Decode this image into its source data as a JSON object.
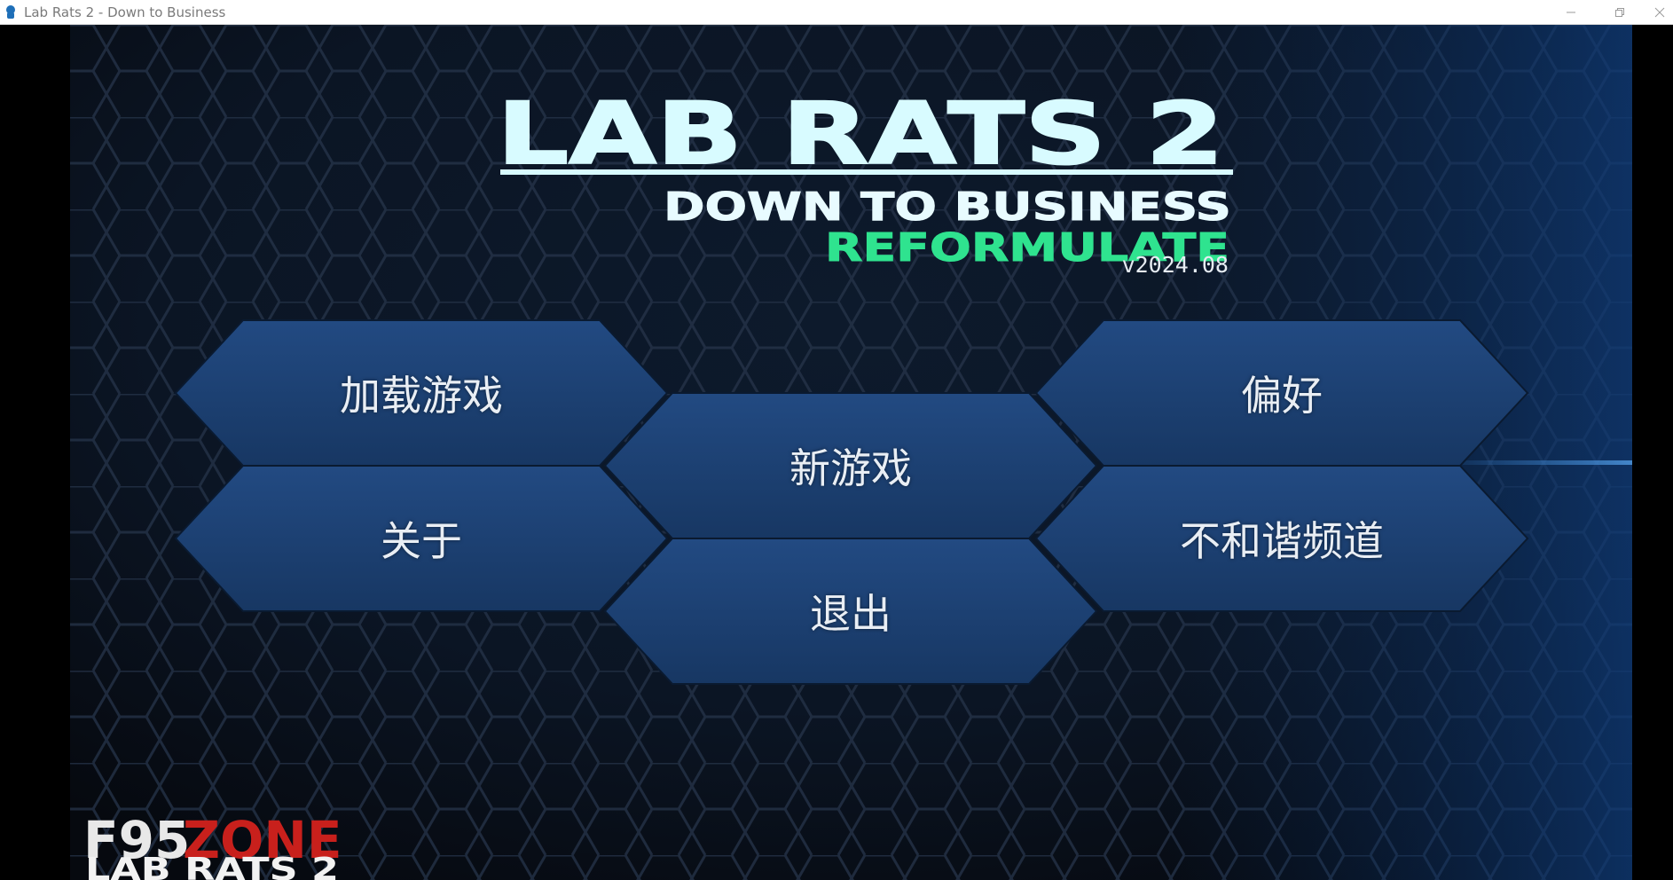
{
  "window": {
    "title": "Lab Rats 2 - Down to Business"
  },
  "game": {
    "logo": {
      "title": "LAB RATS 2",
      "subtitle": "DOWN TO BUSINESS",
      "edition": "REFORMULATE"
    },
    "version": "v2024.08",
    "menu": {
      "load_game": "加载游戏",
      "new_game": "新游戏",
      "preferences": "偏好",
      "about": "关于",
      "quit": "退出",
      "discord": "不和谐频道"
    },
    "watermark": {
      "line1_part1": "F95",
      "line1_part2": "ZONE",
      "line2": "LAB RATS 2"
    }
  },
  "colors": {
    "title_cyan": "#d8fbff",
    "edition_green": "#2fe38f",
    "button_fill": "#1c3e70",
    "watermark_red": "#c8201c"
  }
}
